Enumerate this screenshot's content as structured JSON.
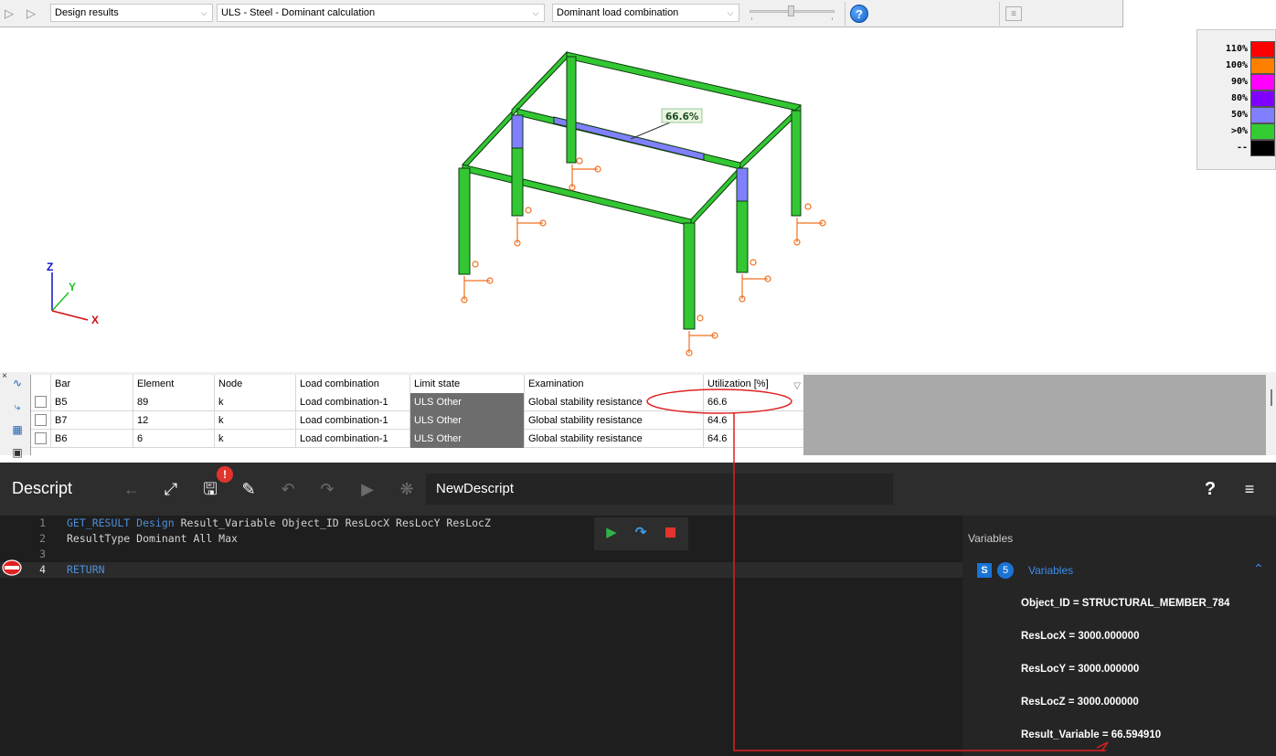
{
  "toolbar": {
    "result_group": "Design results",
    "result_type": "ULS - Steel - Dominant calculation",
    "combination": "Dominant load combination"
  },
  "model_view": {
    "label_value": "66.6%",
    "axes": {
      "z": "Z",
      "y": "Y",
      "x": "X"
    }
  },
  "legend": [
    {
      "label": "110%",
      "color": "#ff0000"
    },
    {
      "label": "100%",
      "color": "#ff8000"
    },
    {
      "label": "90%",
      "color": "#ff00ff"
    },
    {
      "label": "80%",
      "color": "#8000ff"
    },
    {
      "label": "50%",
      "color": "#8080ff"
    },
    {
      "label": ">0%",
      "color": "#33cc33"
    },
    {
      "label": "--",
      "color": "#000000"
    }
  ],
  "table": {
    "headers": [
      "Bar",
      "Element",
      "Node",
      "Load combination",
      "Limit state",
      "Examination",
      "Utilization [%]"
    ],
    "rows": [
      [
        "B5",
        "89",
        "k",
        "Load combination-1",
        "ULS Other",
        "Global stability resistance",
        "66.6"
      ],
      [
        "B7",
        "12",
        "k",
        "Load combination-1",
        "ULS Other",
        "Global stability resistance",
        "64.6"
      ],
      [
        "B6",
        "6",
        "k",
        "Load combination-1",
        "ULS Other",
        "Global stability resistance",
        "64.6"
      ]
    ]
  },
  "descript": {
    "title": "Descript",
    "save_badge": "!",
    "script_name": "NewDescript",
    "code": [
      {
        "n": "1",
        "kw": "GET_RESULT Design",
        "rest": " Result_Variable Object_ID ResLocX ResLocY ResLocZ"
      },
      {
        "n": "2",
        "kw": "",
        "rest": "ResultType Dominant All Max"
      },
      {
        "n": "3",
        "kw": "",
        "rest": ""
      },
      {
        "n": "4",
        "kw": "RETURN",
        "rest": ""
      }
    ],
    "help": "?",
    "variables": {
      "title": "Variables",
      "section_badge": "S",
      "count": "5",
      "section_label": "Variables",
      "items": [
        "Object_ID = STRUCTURAL_MEMBER_784",
        "ResLocX = 3000.000000",
        "ResLocY = 3000.000000",
        "ResLocZ = 3000.000000",
        "Result_Variable = 66.594910"
      ]
    }
  }
}
